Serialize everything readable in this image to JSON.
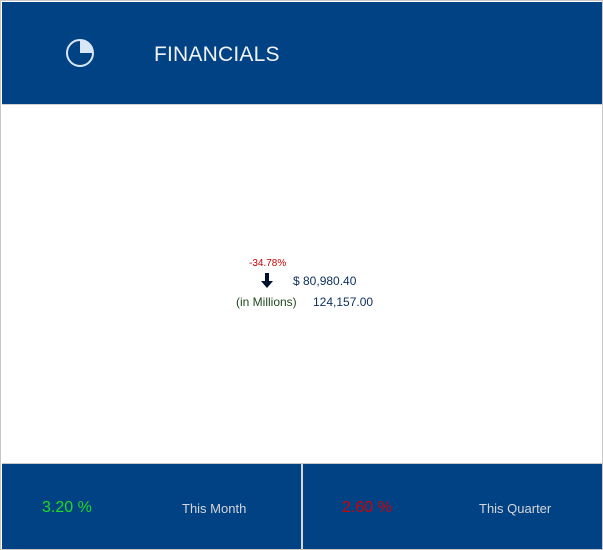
{
  "header": {
    "title": "FINANCIALS",
    "icon": "pie-chart-icon"
  },
  "kpi": {
    "change_percent": "-34.78%",
    "trend_icon": "arrow-down-icon",
    "current_value": "$ 80,980.40",
    "unit_label": "(in Millions)",
    "previous_value": "124,157.00"
  },
  "footer": {
    "month": {
      "value": "3.20 %",
      "label": "This Month"
    },
    "quarter": {
      "value": "2.60 %",
      "label": "This Quarter"
    }
  },
  "colors": {
    "brand": "#014284",
    "positive": "#1fdc1f",
    "negative": "#d40000",
    "trend_down": "#cc0000"
  }
}
